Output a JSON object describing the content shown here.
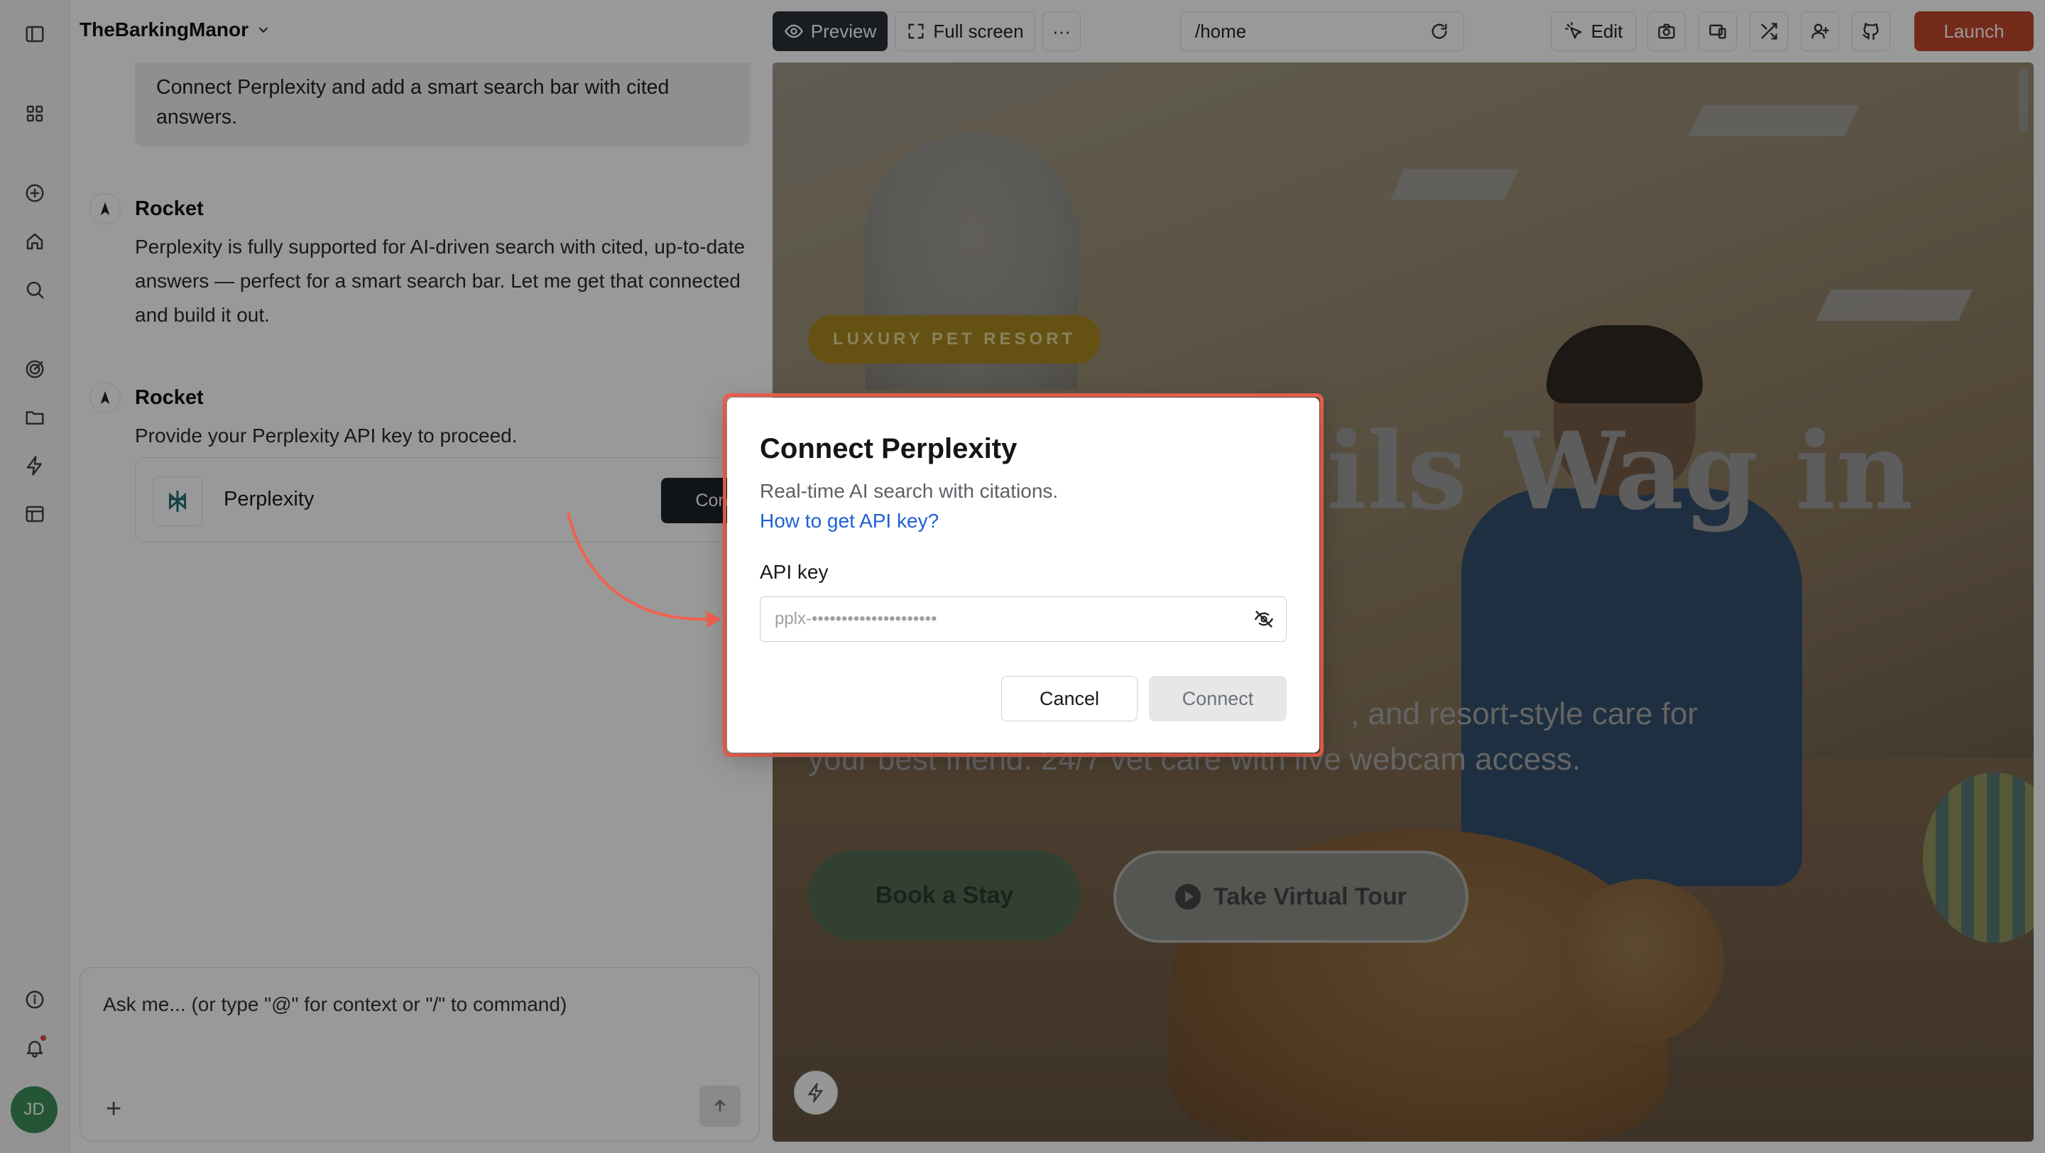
{
  "project": {
    "name": "TheBarkingManor"
  },
  "chat": {
    "user_message": "Connect Perplexity and add a smart search bar with cited answers.",
    "messages": [
      {
        "sender": "Rocket",
        "text": "Perplexity is fully supported for AI-driven search with cited, up-to-date answers — perfect for a smart search bar. Let me get that connected and build it out."
      },
      {
        "sender": "Rocket",
        "text": "Provide your Perplexity API key to proceed."
      }
    ],
    "integration_card": {
      "name": "Perplexity",
      "button": "Connect"
    },
    "composer": {
      "placeholder": "Ask me... (or type \"@\" for context or \"/\" to command)"
    }
  },
  "toolbar": {
    "preview": "Preview",
    "fullscreen": "Full screen",
    "more": "···",
    "route": "/home",
    "edit": "Edit",
    "launch": "Launch"
  },
  "site_preview": {
    "badge": "LUXURY PET RESORT",
    "title_fragment": "ils Wag in",
    "subtitle": ", and resort-style care for your best friend. 24/7 vet care with live webcam access.",
    "primary_cta": "Book a Stay",
    "secondary_cta": "Take Virtual Tour"
  },
  "modal": {
    "title": "Connect Perplexity",
    "description": "Real-time AI search with citations.",
    "help_link": "How to get API key?",
    "field_label": "API key",
    "field_placeholder": "pplx-•••••••••••••••••••••",
    "cancel": "Cancel",
    "connect": "Connect"
  },
  "user": {
    "initials": "JD"
  },
  "colors": {
    "launch": "#c2462a",
    "preview_active": "#2a2f36",
    "modal_highlight": "#f2624e",
    "link": "#1c61d6",
    "avatar": "#3d8f5a"
  }
}
